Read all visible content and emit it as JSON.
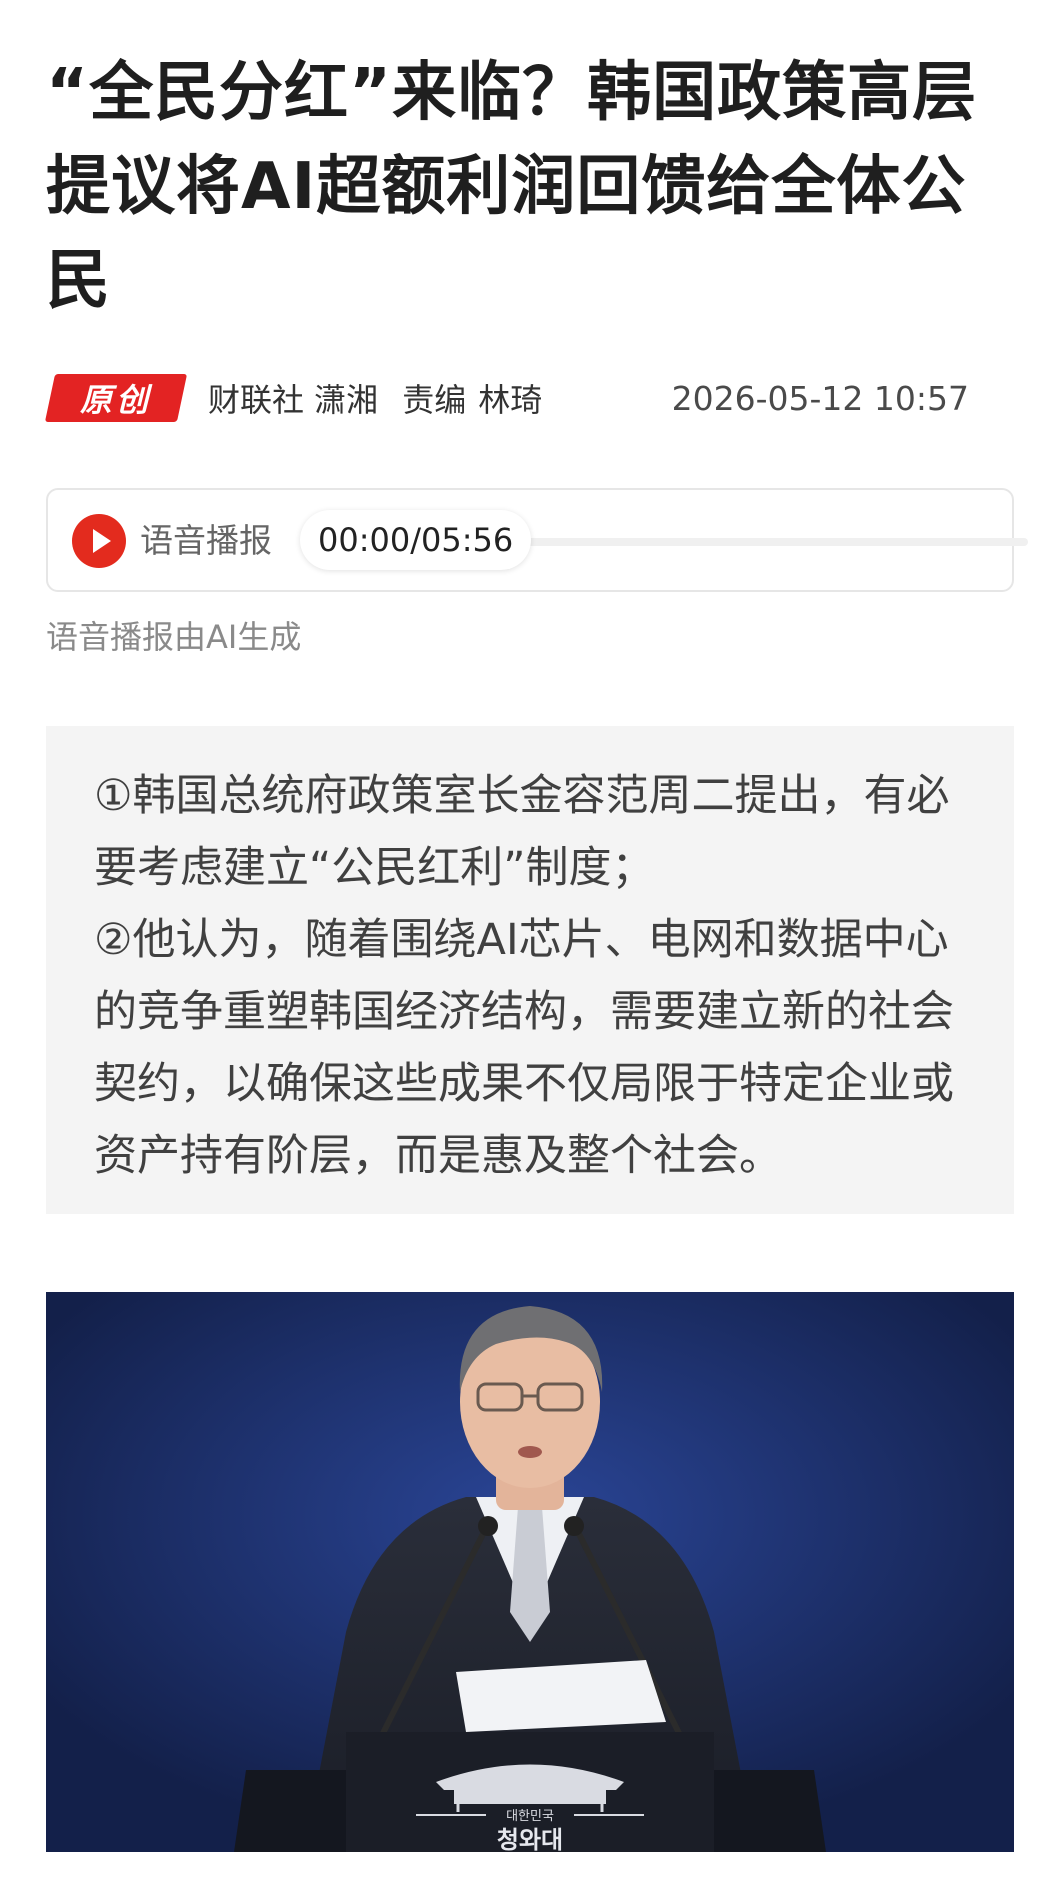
{
  "article": {
    "headline": "“全民分红”来临？韩国政策高层提议将AI超额利润回馈给全体公民",
    "badge": "原创",
    "source": "财联社 潇湘",
    "editor_label": "责编",
    "editor_name": "林琦",
    "datetime": "2026-05-12 10:57"
  },
  "audio": {
    "label": "语音播报",
    "time": "00:00/05:56",
    "progress": 0,
    "note": "语音播报由AI生成",
    "play_icon": "play-icon",
    "accent": "#e32b1e"
  },
  "summary": {
    "text": "①韩国总统府政策室长金容范周二提出，有必要考虑建立“公民红利”制度；\n②他认为，随着围绕AI芯片、电网和数据中心的竞争重塑韩国经济结构，需要建立新的社会契约，以确保这些成果不仅局限于特定企业或资产持有阶层，而是惠及整个社会。"
  },
  "photo": {
    "podium_korean_top": "대한민국",
    "podium_korean_main": "청와대"
  },
  "colors": {
    "badge_red": "#e32323",
    "summary_bg": "#f4f4f4",
    "photo_bg": "#1a2d66"
  }
}
